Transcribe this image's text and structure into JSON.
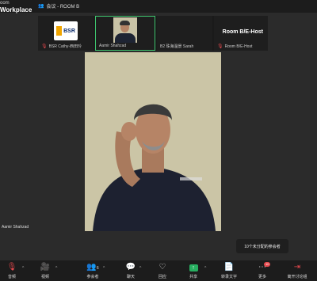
{
  "brand": {
    "line1": "oom",
    "line2": "Workplace"
  },
  "meeting": {
    "title": "会议 - ROOM B"
  },
  "participants": [
    {
      "name": "BSR Cathy-西田玲",
      "logo": "BSR"
    },
    {
      "name": "Aamir Shahzad"
    },
    {
      "name": "B2 珠海温景 Sarah"
    },
    {
      "name": "Room B/E-Host",
      "big_label": "Room B/E-Host"
    }
  ],
  "main": {
    "speaker_label": "Aamir Shahzad"
  },
  "tooltip": {
    "text": "10个未分配的参会者"
  },
  "toolbar": {
    "items": [
      {
        "label": "音频",
        "icon": "mic-off-icon"
      },
      {
        "label": "视频",
        "icon": "video-off-icon"
      },
      {
        "label": "参会者",
        "icon": "participants-icon",
        "count": "6"
      },
      {
        "label": "聊天",
        "icon": "chat-icon"
      },
      {
        "label": "回应",
        "icon": "reaction-icon"
      },
      {
        "label": "共享",
        "icon": "share-icon"
      },
      {
        "label": "转录文字",
        "icon": "transcript-icon"
      },
      {
        "label": "更多",
        "icon": "more-icon",
        "badge": "10"
      },
      {
        "label": "离开讨论组",
        "icon": "leave-icon"
      }
    ]
  },
  "colors": {
    "accent": "#3ec46d",
    "alert": "#e5484d",
    "share": "#27ae60"
  }
}
